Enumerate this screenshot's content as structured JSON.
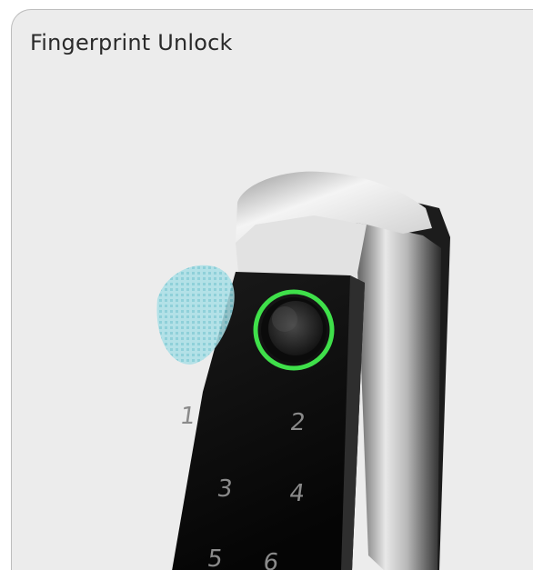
{
  "card": {
    "title": "Fingerprint Unlock"
  },
  "lock_image": {
    "ring_color": "#3fe04a",
    "keypad_digits": [
      "1",
      "2",
      "3",
      "4",
      "5",
      "6"
    ]
  }
}
